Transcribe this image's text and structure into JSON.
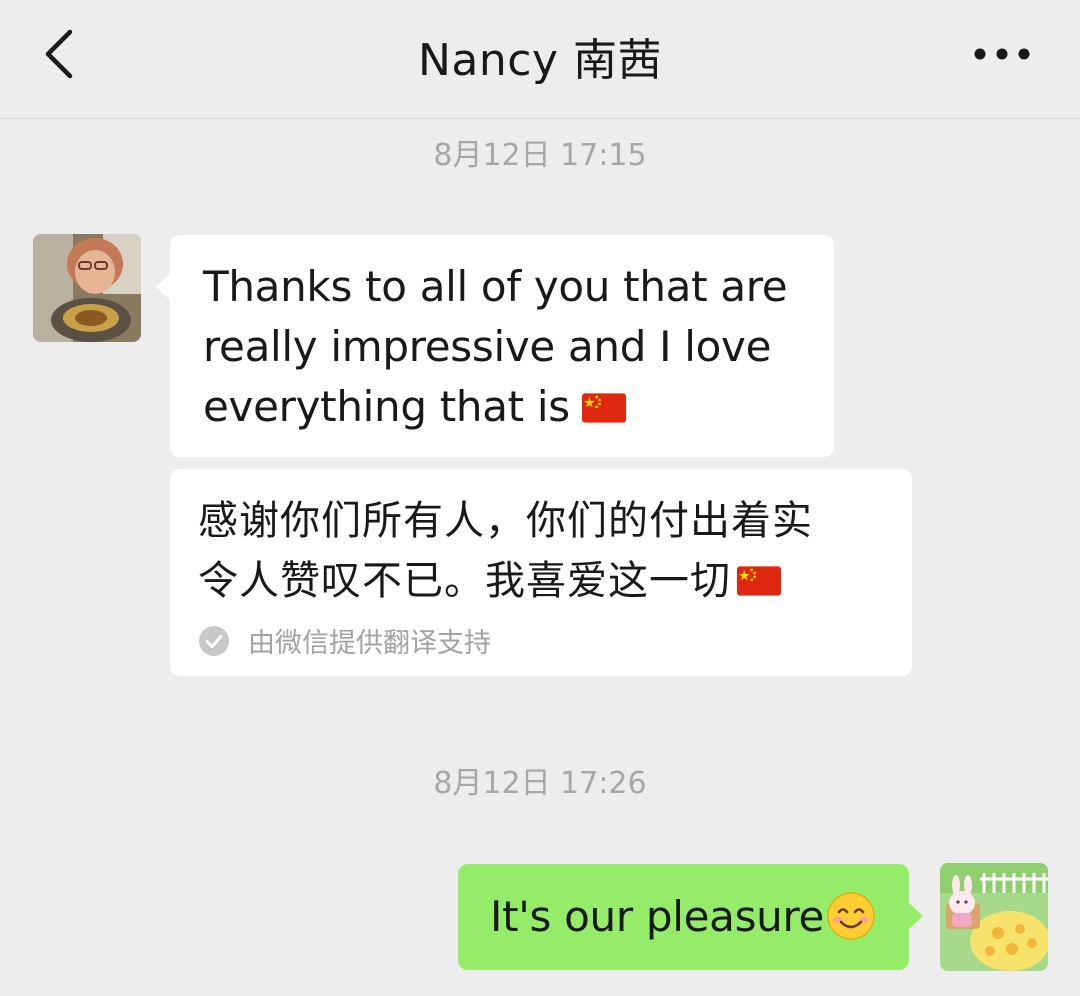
{
  "header": {
    "title": "Nancy 南茜",
    "back_icon": "chevron-left-icon",
    "more_icon": "more-dots-icon"
  },
  "messages": [
    {
      "timestamp": "8月12日 17:15",
      "sender": "Nancy",
      "text": "Thanks to all of you that are\nreally impressive and I love\neverything that is",
      "trailing_emoji": "china-flag",
      "translation": {
        "text": "感谢你们所有人，你们的付出着实\n令人赞叹不已。我喜爱这一切",
        "trailing_emoji": "china-flag",
        "provider_note": "由微信提供翻译支持",
        "provider_icon": "check-circle-icon"
      }
    },
    {
      "timestamp": "8月12日 17:26",
      "sender": "self",
      "text": "It's our pleasure",
      "trailing_emoji": "smiling-face"
    }
  ],
  "colors": {
    "background": "#ededed",
    "incoming_bubble": "#ffffff",
    "outgoing_bubble": "#95ec69",
    "timestamp_text": "#a7a7a7",
    "body_text": "#191919"
  }
}
